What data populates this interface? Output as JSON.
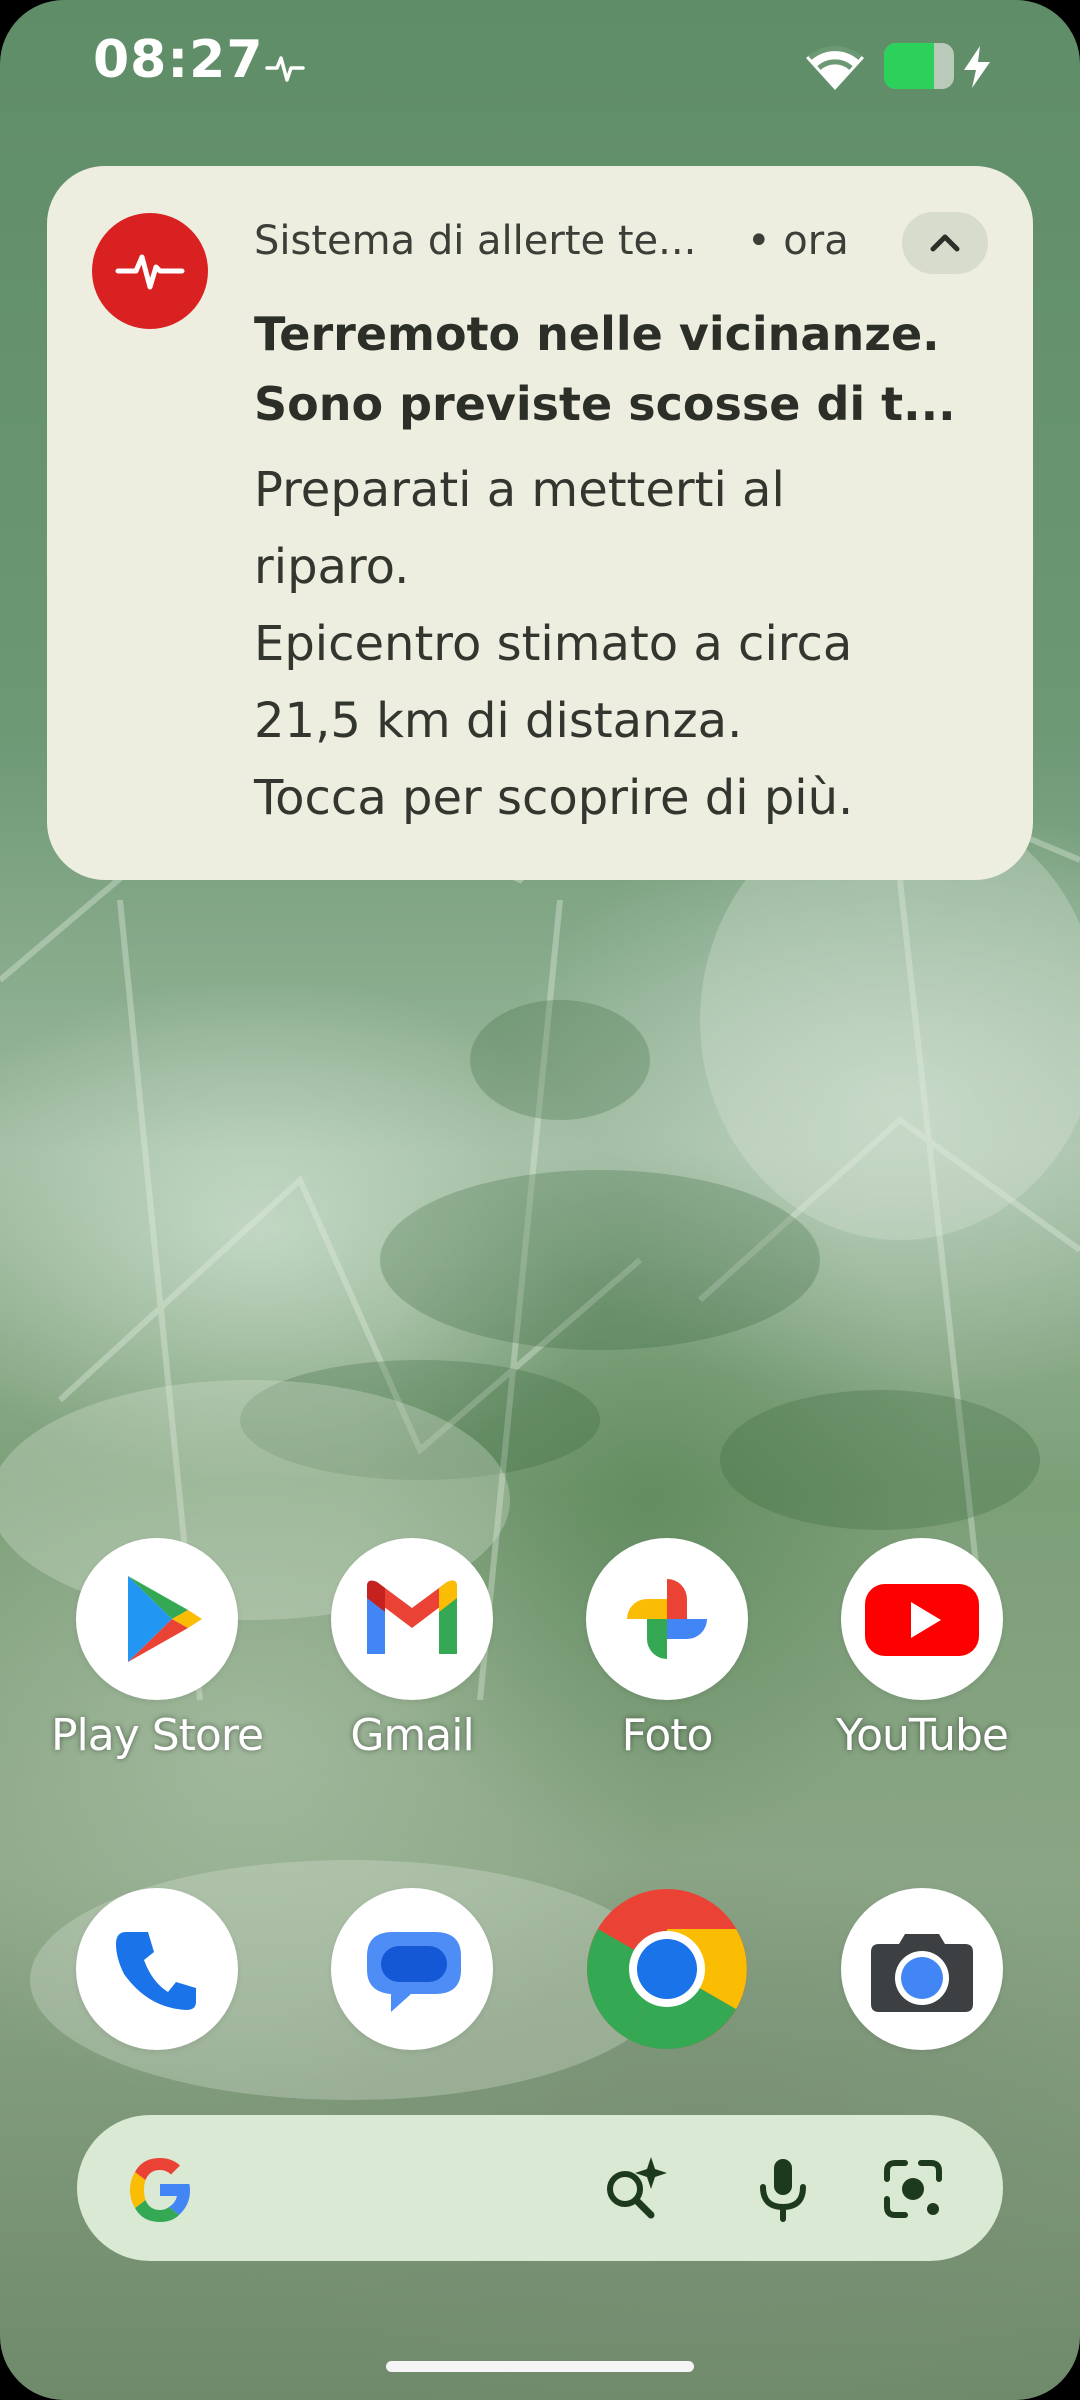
{
  "status_bar": {
    "time": "08:27",
    "battery_level": 0.72,
    "icons": [
      "earthquake-pulse-icon",
      "wifi-icon",
      "battery-icon",
      "charging-bolt-icon"
    ]
  },
  "notification": {
    "app_name": "Sistema di allerte te...",
    "time": "• ora",
    "title_line1": "Terremoto nelle vicinanze.",
    "title_line2": "Sono previste scosse di t...",
    "body_lines": [
      "Preparati a metterti al",
      "riparo.",
      "Epicentro stimato a circa",
      "21,5 km di distanza.",
      "Tocca per scoprire di più."
    ],
    "icon": "earthquake-alert-icon",
    "colors": {
      "background": "#eeeee0",
      "icon_bg": "#d82120"
    }
  },
  "apps": [
    {
      "label": "Play Store",
      "icon": "play-store-icon"
    },
    {
      "label": "Gmail",
      "icon": "gmail-icon"
    },
    {
      "label": "Foto",
      "icon": "photos-icon"
    },
    {
      "label": "YouTube",
      "icon": "youtube-icon"
    }
  ],
  "dock": [
    {
      "icon": "phone-icon"
    },
    {
      "icon": "messages-icon"
    },
    {
      "icon": "chrome-icon"
    },
    {
      "icon": "camera-icon"
    }
  ],
  "search_bar": {
    "icons": [
      "google-logo-icon",
      "ai-mode-icon",
      "microphone-icon",
      "lens-icon"
    ]
  }
}
